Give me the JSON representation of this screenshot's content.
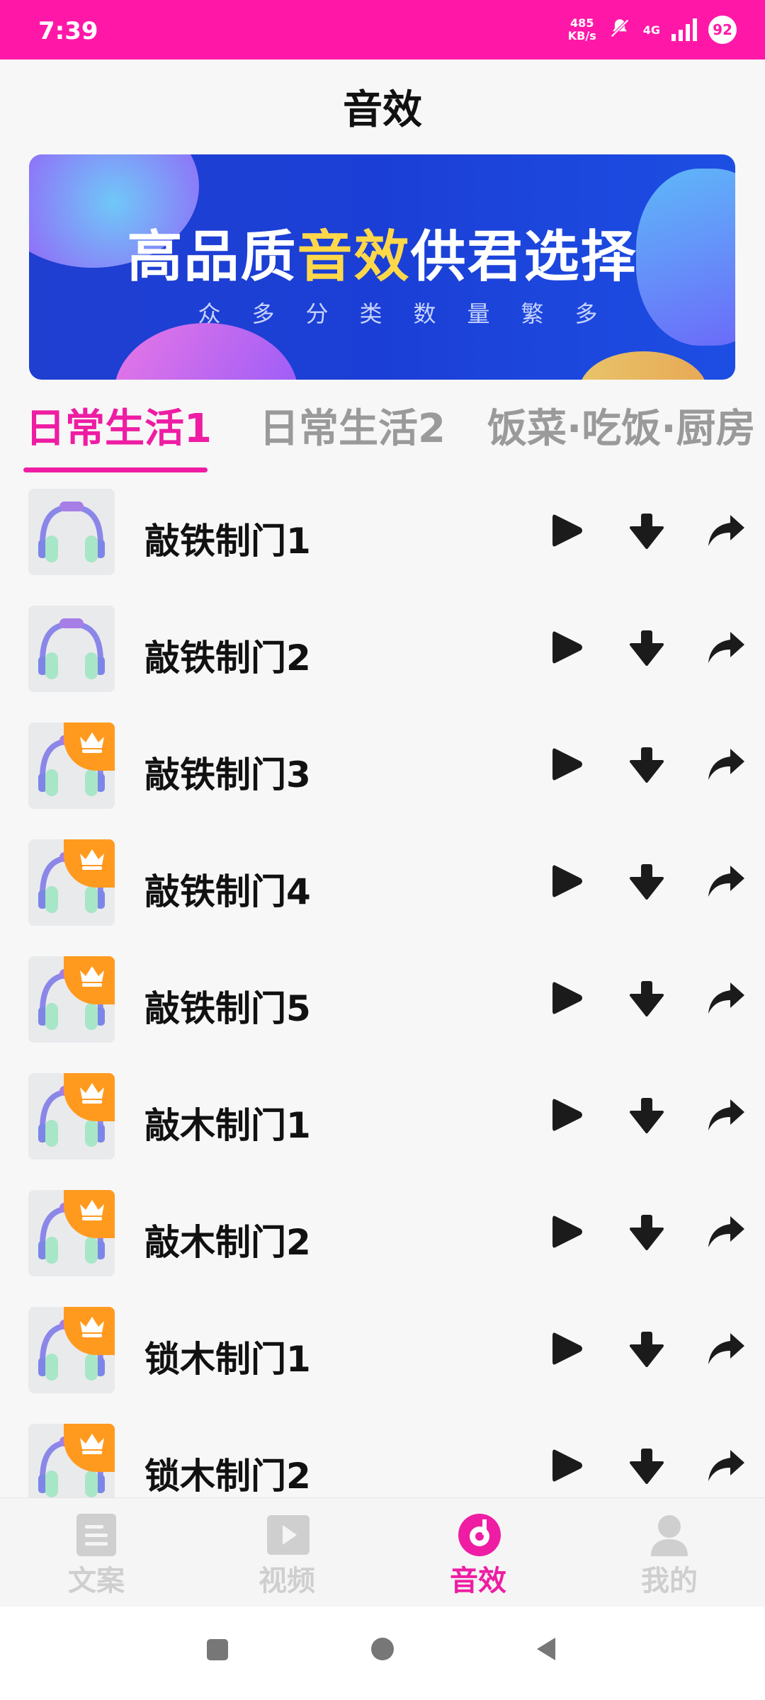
{
  "status_bar": {
    "time": "7:39",
    "net_speed_value": "485",
    "net_speed_unit": "KB/s",
    "network_type": "4G",
    "battery": "92"
  },
  "page": {
    "title": "音效"
  },
  "banner": {
    "title_part1": "高品质",
    "title_highlight": "音效",
    "title_part2": "供君选择",
    "subtitle": "众多分类数量繁多"
  },
  "tabs": [
    {
      "label": "日常生活1",
      "active": true
    },
    {
      "label": "日常生活2",
      "active": false
    },
    {
      "label": "饭菜·吃饭·厨房",
      "active": false
    }
  ],
  "sounds": [
    {
      "name": "敲铁制门1",
      "vip": false
    },
    {
      "name": "敲铁制门2",
      "vip": false
    },
    {
      "name": "敲铁制门3",
      "vip": true
    },
    {
      "name": "敲铁制门4",
      "vip": true
    },
    {
      "name": "敲铁制门5",
      "vip": true
    },
    {
      "name": "敲木制门1",
      "vip": true
    },
    {
      "name": "敲木制门2",
      "vip": true
    },
    {
      "name": "锁木制门1",
      "vip": true
    },
    {
      "name": "锁木制门2",
      "vip": true
    }
  ],
  "bottom_nav": [
    {
      "label": "文案",
      "icon": "document-icon",
      "active": false
    },
    {
      "label": "视频",
      "icon": "video-play-icon",
      "active": false
    },
    {
      "label": "音效",
      "icon": "music-disc-icon",
      "active": true
    },
    {
      "label": "我的",
      "icon": "person-icon",
      "active": false
    }
  ],
  "colors": {
    "accent": "#ee1da3",
    "status_bar": "#ff18a8",
    "vip_badge": "#ff9a1f"
  }
}
